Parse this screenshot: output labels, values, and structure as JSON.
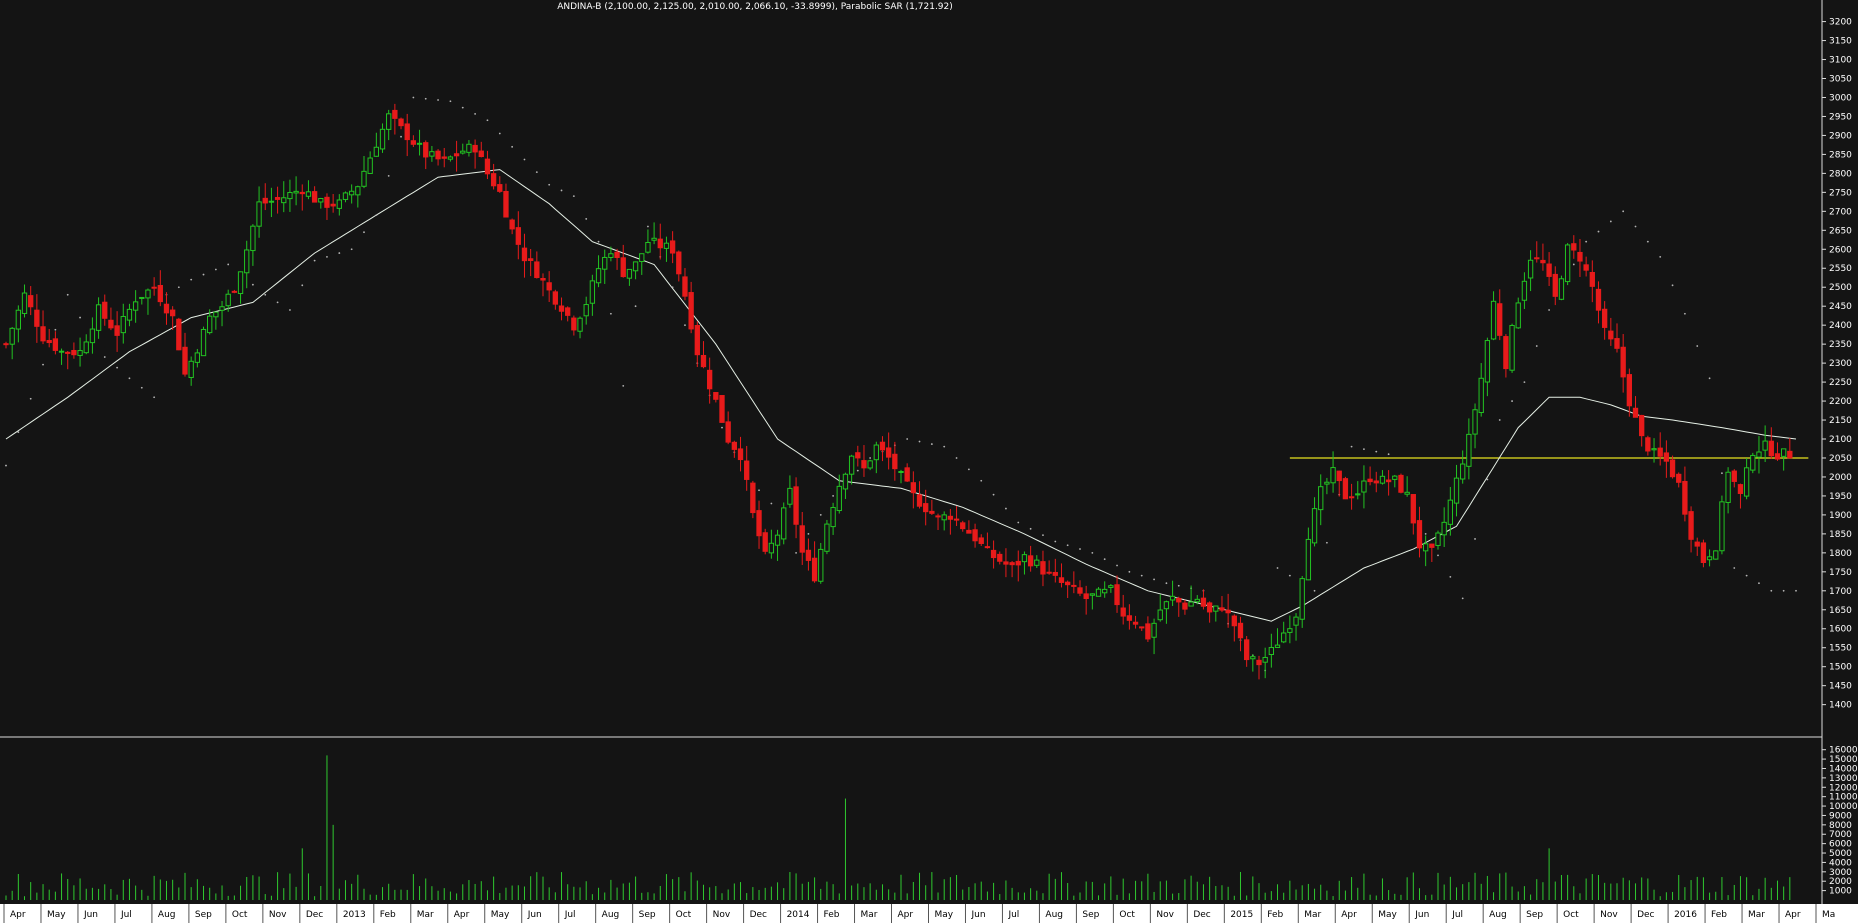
{
  "title": "ANDINA-B (2,100.00, 2,125.00, 2,010.00, 2,066.10, -33.8999), Parabolic SAR (1,721.92)",
  "colors": {
    "background": "#141414",
    "up_candle": "#22c322",
    "down_candle": "#e81b1b",
    "moving_average": "#e6f0e6",
    "sar": "#b4b4b4",
    "support_line": "#e6e21e",
    "volume": "#2fc92f",
    "axis_text": "#ffffff"
  },
  "chart_data": [
    {
      "type": "candlestick",
      "title": "ANDINA-B (2,100.00, 2,125.00, 2,010.00, 2,066.10, -33.8999), Parabolic SAR (1,721.92)",
      "ylim": [
        1320,
        3220
      ],
      "y_ticks": [
        3200,
        3150,
        3100,
        3050,
        3000,
        2950,
        2900,
        2850,
        2800,
        2750,
        2700,
        2650,
        2600,
        2550,
        2500,
        2450,
        2400,
        2350,
        2300,
        2250,
        2200,
        2150,
        2100,
        2050,
        2000,
        1950,
        1900,
        1850,
        1800,
        1750,
        1700,
        1650,
        1600,
        1550,
        1500,
        1450,
        1400
      ],
      "x_labels": [
        "Apr",
        "May",
        "Jun",
        "Jul",
        "Aug",
        "Sep",
        "Oct",
        "Nov",
        "Dec",
        "2013",
        "Feb",
        "Mar",
        "Apr",
        "May",
        "Jun",
        "Jul",
        "Aug",
        "Sep",
        "Oct",
        "Nov",
        "Dec",
        "2014",
        "Feb",
        "Mar",
        "Apr",
        "May",
        "Jun",
        "Jul",
        "Aug",
        "Sep",
        "Oct",
        "Nov",
        "Dec",
        "2015",
        "Feb",
        "Mar",
        "Apr",
        "May",
        "Jun",
        "Jul",
        "Aug",
        "Sep",
        "Oct",
        "Nov",
        "Dec",
        "2016",
        "Feb",
        "Mar",
        "Apr",
        "Ma"
      ],
      "support_level": 2050,
      "close_keypoints": [
        [
          0,
          2350
        ],
        [
          3,
          2480
        ],
        [
          6,
          2370
        ],
        [
          9,
          2330
        ],
        [
          12,
          2330
        ],
        [
          15,
          2440
        ],
        [
          18,
          2380
        ],
        [
          21,
          2470
        ],
        [
          24,
          2500
        ],
        [
          27,
          2420
        ],
        [
          29,
          2270
        ],
        [
          31,
          2340
        ],
        [
          33,
          2420
        ],
        [
          35,
          2450
        ],
        [
          37,
          2500
        ],
        [
          39,
          2600
        ],
        [
          41,
          2720
        ],
        [
          44,
          2730
        ],
        [
          48,
          2760
        ],
        [
          51,
          2720
        ],
        [
          54,
          2720
        ],
        [
          57,
          2770
        ],
        [
          60,
          2880
        ],
        [
          62,
          2950
        ],
        [
          65,
          2900
        ],
        [
          68,
          2850
        ],
        [
          71,
          2830
        ],
        [
          74,
          2860
        ],
        [
          76,
          2870
        ],
        [
          78,
          2800
        ],
        [
          80,
          2750
        ],
        [
          82,
          2650
        ],
        [
          84,
          2580
        ],
        [
          86,
          2540
        ],
        [
          88,
          2490
        ],
        [
          90,
          2450
        ],
        [
          92,
          2400
        ],
        [
          94,
          2460
        ],
        [
          96,
          2550
        ],
        [
          98,
          2600
        ],
        [
          100,
          2540
        ],
        [
          102,
          2560
        ],
        [
          104,
          2620
        ],
        [
          106,
          2610
        ],
        [
          108,
          2600
        ],
        [
          110,
          2480
        ],
        [
          112,
          2330
        ],
        [
          115,
          2200
        ],
        [
          117,
          2100
        ],
        [
          119,
          2060
        ],
        [
          121,
          1900
        ],
        [
          123,
          1790
        ],
        [
          125,
          1850
        ],
        [
          127,
          1960
        ],
        [
          129,
          1800
        ],
        [
          131,
          1740
        ],
        [
          133,
          1880
        ],
        [
          135,
          1980
        ],
        [
          137,
          2060
        ],
        [
          139,
          2020
        ],
        [
          141,
          2080
        ],
        [
          143,
          2050
        ],
        [
          145,
          2000
        ],
        [
          147,
          1950
        ],
        [
          149,
          1920
        ],
        [
          151,
          1890
        ],
        [
          153,
          1900
        ],
        [
          155,
          1870
        ],
        [
          157,
          1840
        ],
        [
          159,
          1800
        ],
        [
          161,
          1780
        ],
        [
          163,
          1760
        ],
        [
          165,
          1790
        ],
        [
          167,
          1770
        ],
        [
          169,
          1740
        ],
        [
          171,
          1720
        ],
        [
          173,
          1700
        ],
        [
          175,
          1680
        ],
        [
          177,
          1690
        ],
        [
          179,
          1700
        ],
        [
          181,
          1640
        ],
        [
          183,
          1620
        ],
        [
          185,
          1580
        ],
        [
          187,
          1650
        ],
        [
          189,
          1680
        ],
        [
          191,
          1660
        ],
        [
          193,
          1680
        ],
        [
          195,
          1640
        ],
        [
          197,
          1660
        ],
        [
          199,
          1610
        ],
        [
          201,
          1520
        ],
        [
          203,
          1510
        ],
        [
          205,
          1540
        ],
        [
          207,
          1590
        ],
        [
          209,
          1640
        ],
        [
          211,
          1850
        ],
        [
          213,
          1960
        ],
        [
          215,
          2010
        ],
        [
          217,
          1950
        ],
        [
          219,
          1960
        ],
        [
          221,
          2000
        ],
        [
          223,
          1990
        ],
        [
          225,
          1990
        ],
        [
          227,
          1950
        ],
        [
          229,
          1820
        ],
        [
          231,
          1800
        ],
        [
          233,
          1880
        ],
        [
          235,
          1990
        ],
        [
          237,
          2100
        ],
        [
          239,
          2260
        ],
        [
          241,
          2460
        ],
        [
          243,
          2300
        ],
        [
          245,
          2470
        ],
        [
          247,
          2580
        ],
        [
          249,
          2560
        ],
        [
          251,
          2470
        ],
        [
          253,
          2600
        ],
        [
          255,
          2580
        ],
        [
          257,
          2500
        ],
        [
          259,
          2380
        ],
        [
          261,
          2330
        ],
        [
          263,
          2200
        ],
        [
          265,
          2100
        ],
        [
          267,
          2060
        ],
        [
          269,
          2040
        ],
        [
          271,
          1980
        ],
        [
          273,
          1850
        ],
        [
          275,
          1780
        ],
        [
          277,
          1820
        ],
        [
          279,
          2020
        ],
        [
          281,
          1950
        ],
        [
          283,
          2070
        ],
        [
          285,
          2080
        ],
        [
          287,
          2060
        ]
      ],
      "moving_average_keypoints": [
        [
          0,
          2100
        ],
        [
          10,
          2210
        ],
        [
          20,
          2330
        ],
        [
          30,
          2420
        ],
        [
          40,
          2460
        ],
        [
          50,
          2590
        ],
        [
          60,
          2690
        ],
        [
          70,
          2790
        ],
        [
          80,
          2810
        ],
        [
          88,
          2720
        ],
        [
          95,
          2620
        ],
        [
          105,
          2560
        ],
        [
          115,
          2350
        ],
        [
          125,
          2100
        ],
        [
          135,
          1990
        ],
        [
          145,
          1970
        ],
        [
          155,
          1920
        ],
        [
          165,
          1850
        ],
        [
          175,
          1770
        ],
        [
          185,
          1700
        ],
        [
          195,
          1660
        ],
        [
          200,
          1640
        ],
        [
          205,
          1620
        ],
        [
          210,
          1660
        ],
        [
          220,
          1760
        ],
        [
          228,
          1810
        ],
        [
          235,
          1870
        ],
        [
          240,
          2000
        ],
        [
          245,
          2130
        ],
        [
          250,
          2210
        ],
        [
          255,
          2210
        ],
        [
          260,
          2190
        ],
        [
          265,
          2160
        ],
        [
          270,
          2150
        ],
        [
          278,
          2130
        ],
        [
          285,
          2110
        ],
        [
          290,
          2100
        ]
      ],
      "sar_keypoints": [
        [
          0,
          2030
        ],
        [
          5,
          2250
        ],
        [
          10,
          2480
        ],
        [
          15,
          2330
        ],
        [
          20,
          2260
        ],
        [
          24,
          2210
        ],
        [
          26,
          2480
        ],
        [
          30,
          2520
        ],
        [
          36,
          2560
        ],
        [
          42,
          2480
        ],
        [
          46,
          2440
        ],
        [
          50,
          2570
        ],
        [
          56,
          2600
        ],
        [
          60,
          2690
        ],
        [
          66,
          3000
        ],
        [
          72,
          2990
        ],
        [
          78,
          2940
        ],
        [
          82,
          2870
        ],
        [
          88,
          2770
        ],
        [
          92,
          2740
        ],
        [
          96,
          2620
        ],
        [
          100,
          2240
        ],
        [
          104,
          2660
        ],
        [
          108,
          2500
        ],
        [
          112,
          2300
        ],
        [
          116,
          2130
        ],
        [
          120,
          2000
        ],
        [
          124,
          1930
        ],
        [
          128,
          1800
        ],
        [
          134,
          1950
        ],
        [
          140,
          2050
        ],
        [
          146,
          2100
        ],
        [
          152,
          2080
        ],
        [
          158,
          1990
        ],
        [
          164,
          1880
        ],
        [
          170,
          1830
        ],
        [
          176,
          1800
        ],
        [
          182,
          1750
        ],
        [
          188,
          1720
        ],
        [
          194,
          1700
        ],
        [
          200,
          1570
        ],
        [
          204,
          1490
        ],
        [
          206,
          1760
        ],
        [
          212,
          1700
        ],
        [
          218,
          2080
        ],
        [
          224,
          2060
        ],
        [
          230,
          1850
        ],
        [
          236,
          1680
        ],
        [
          242,
          2150
        ],
        [
          246,
          2250
        ],
        [
          250,
          2440
        ],
        [
          256,
          2620
        ],
        [
          262,
          2700
        ],
        [
          268,
          2580
        ],
        [
          272,
          2430
        ],
        [
          276,
          2260
        ],
        [
          280,
          1760
        ],
        [
          286,
          1700
        ]
      ],
      "volume_ylim": [
        0,
        16500
      ],
      "volume_ticks": [
        16000,
        15000,
        14000,
        13000,
        12000,
        11000,
        10000,
        9000,
        8000,
        7000,
        6000,
        5000,
        4000,
        3000,
        2000,
        1000
      ],
      "volume_spikes": [
        [
          48,
          5500
        ],
        [
          52,
          15400
        ],
        [
          53,
          8000
        ],
        [
          136,
          10800
        ],
        [
          250,
          5500
        ]
      ],
      "num_periods": 290
    }
  ]
}
